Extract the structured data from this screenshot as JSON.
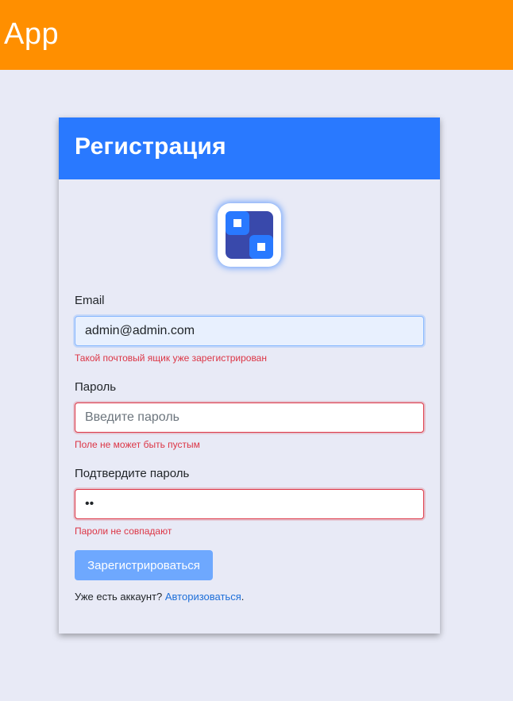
{
  "app": {
    "title": "App"
  },
  "card": {
    "title": "Регистрация"
  },
  "form": {
    "email": {
      "label": "Email",
      "value": "admin@admin.com",
      "error": "Такой почтовый ящик уже зарегистрирован"
    },
    "password": {
      "label": "Пароль",
      "value": "",
      "placeholder": "Введите пароль",
      "error": "Поле не может быть пустым"
    },
    "confirm": {
      "label": "Подтвердите пароль",
      "value": "12",
      "error": "Пароли не совпадают"
    },
    "submit_label": "Зарегистрироваться"
  },
  "footer": {
    "prompt": "Уже есть аккаунт? ",
    "login_link": "Авторизоваться",
    "suffix": "."
  },
  "colors": {
    "header_bg": "#ff8f00",
    "card_header_bg": "#2979ff",
    "page_bg": "#e8eaf6",
    "error": "#dc3545",
    "button_bg": "#6ea8fe",
    "link": "#1e6fd9"
  }
}
